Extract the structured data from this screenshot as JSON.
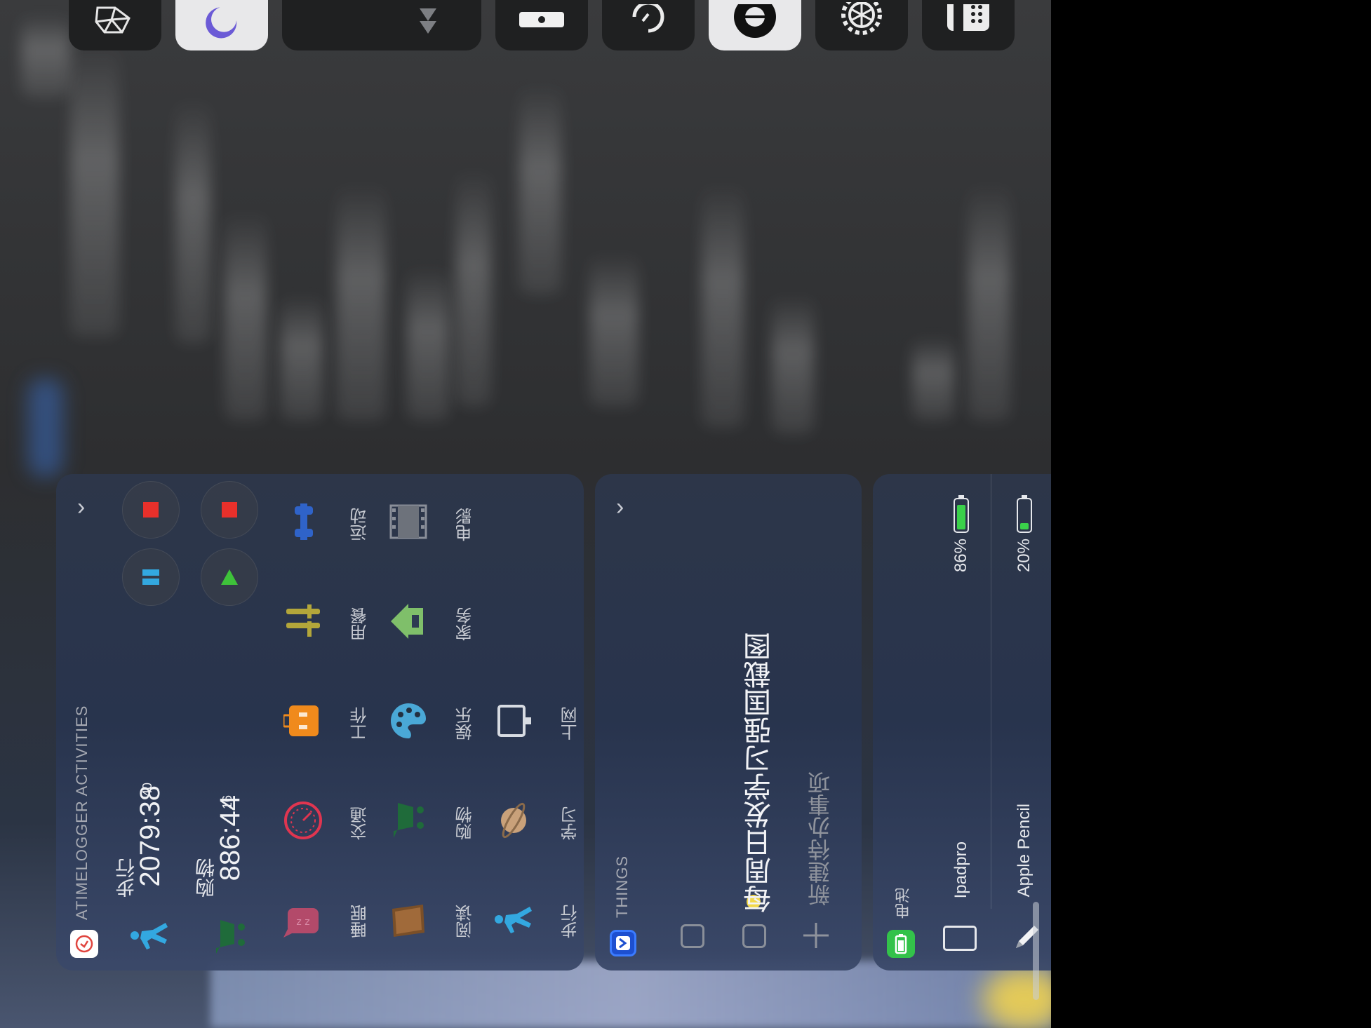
{
  "control_center": {
    "tiles": [
      {
        "icon": "cube-icon"
      },
      {
        "icon": "moon-icon"
      },
      {
        "icon": "volume-down-icon"
      },
      {
        "icon": "flashlight-icon"
      },
      {
        "icon": "timer-icon"
      },
      {
        "icon": "camera-shutter-icon"
      },
      {
        "icon": "settings-gear-icon"
      },
      {
        "icon": "calculator-icon"
      }
    ]
  },
  "atimelogger": {
    "header": "ATIMELOGGER ACTIVITIES",
    "running": [
      {
        "name": "步行",
        "time": "2079:38",
        "seconds": "40",
        "color": "#33a8e0"
      },
      {
        "name": "购物",
        "time": "886:44",
        "seconds": "16",
        "color": "#1f6b3a"
      }
    ],
    "activities": [
      {
        "label": "睡眠",
        "icon": "sleep-icon",
        "color": "#d9487a"
      },
      {
        "label": "交通",
        "icon": "speedometer-icon",
        "color": "#e03550"
      },
      {
        "label": "工作",
        "icon": "briefcase-icon",
        "color": "#f08a1c"
      },
      {
        "label": "用餐",
        "icon": "fork-knife-icon",
        "color": "#b3a63a"
      },
      {
        "label": "运动",
        "icon": "dumbbell-icon",
        "color": "#2f63c9"
      },
      {
        "label": "阅读",
        "icon": "book-icon",
        "color": "#8b5a2b"
      },
      {
        "label": "购物",
        "icon": "shopping-cart-icon",
        "color": "#1f6b3a"
      },
      {
        "label": "娱乐",
        "icon": "palette-icon",
        "color": "#4aa8d6"
      },
      {
        "label": "家务",
        "icon": "house-icon",
        "color": "#7fbf6a"
      },
      {
        "label": "电影",
        "icon": "film-icon",
        "color": "#8a8f99"
      },
      {
        "label": "步行",
        "icon": "walking-icon",
        "color": "#33a8e0"
      },
      {
        "label": "学习",
        "icon": "planet-icon",
        "color": "#c9a17a"
      },
      {
        "label": "上网",
        "icon": "monitor-icon",
        "color": "#d7dbe2"
      }
    ]
  },
  "things": {
    "header": "THINGS",
    "task": "每周日发学习强国截图",
    "new_todo": "新建待办事项"
  },
  "battery": {
    "header": "电池",
    "devices": [
      {
        "name": "Ipadpro",
        "percent": "86%",
        "level": 0.86
      },
      {
        "name": "Apple Pencil",
        "percent": "20%",
        "level": 0.2
      }
    ]
  }
}
